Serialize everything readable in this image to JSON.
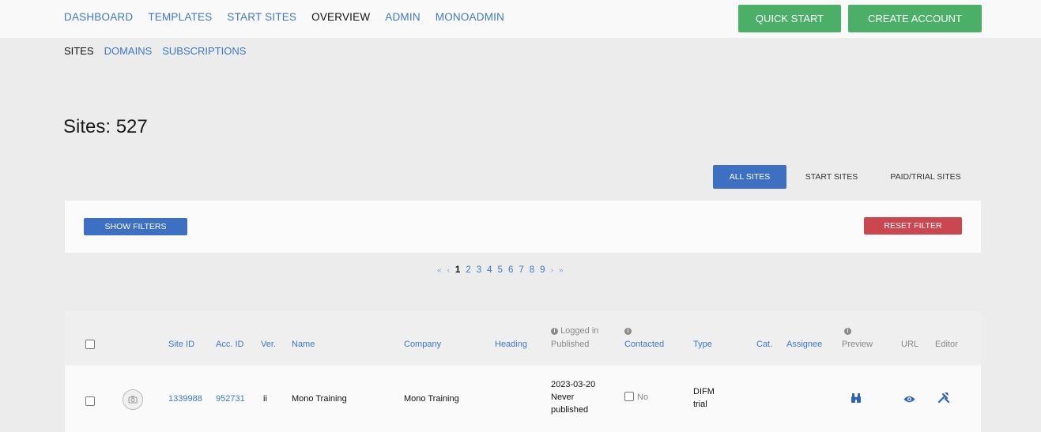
{
  "nav": {
    "items": [
      {
        "label": "DASHBOARD"
      },
      {
        "label": "TEMPLATES"
      },
      {
        "label": "START SITES"
      },
      {
        "label": "OVERVIEW",
        "active": true
      },
      {
        "label": "ADMIN"
      },
      {
        "label": "MONOADMIN"
      }
    ],
    "quick_start": "QUICK START",
    "create_account": "CREATE ACCOUNT"
  },
  "subnav": {
    "items": [
      {
        "label": "SITES",
        "active": true
      },
      {
        "label": "DOMAINS"
      },
      {
        "label": "SUBSCRIPTIONS"
      }
    ]
  },
  "page": {
    "title": "Sites: 527"
  },
  "site_filter": {
    "all": "ALL SITES",
    "start": "START SITES",
    "paid": "PAID/TRIAL SITES",
    "selected": "ALL SITES"
  },
  "filters": {
    "show": "SHOW FILTERS",
    "reset": "RESET FILTER"
  },
  "pagination": {
    "first": "«",
    "prev": "‹",
    "pages": [
      "1",
      "2",
      "3",
      "4",
      "5",
      "6",
      "7",
      "8",
      "9"
    ],
    "current": "1",
    "next": "›",
    "last": "»"
  },
  "table": {
    "headers": {
      "site_id": "Site ID",
      "acc_id": "Acc. ID",
      "ver": "Ver.",
      "name": "Name",
      "company": "Company",
      "heading": "Heading",
      "logged_in": "Logged in",
      "published": "Published",
      "contacted": "Contacted",
      "type": "Type",
      "cat": "Cat.",
      "assignee": "Assignee",
      "preview": "Preview",
      "url": "URL",
      "editor": "Editor"
    },
    "rows": [
      {
        "site_id": "1339988",
        "acc_id": "952731",
        "ver": "ii",
        "name": "Mono Training",
        "company": "Mono Training",
        "logged_in": "2023-03-20",
        "published_1": "Never",
        "published_2": "published",
        "contacted": "No",
        "type_1": "DIFM",
        "type_2": "trial",
        "icons": [
          "binoculars-icon",
          "eye-icon",
          "tools-icon"
        ]
      }
    ]
  },
  "colors": {
    "green": "#4caf67",
    "blue": "#3d6fc2",
    "red": "#cc4650",
    "link": "#3c78c8"
  }
}
